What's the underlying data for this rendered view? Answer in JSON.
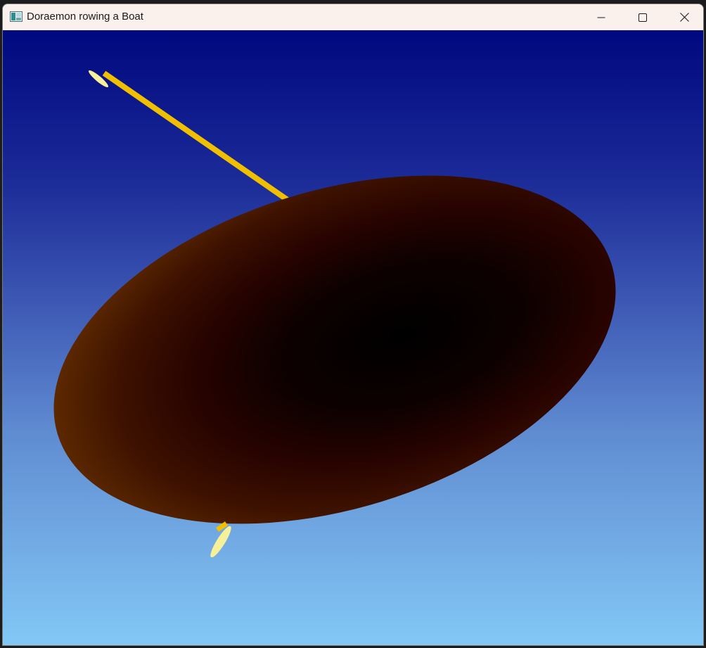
{
  "window": {
    "title": "Doraemon rowing a Boat",
    "icon": "window-app-icon"
  },
  "controls": {
    "minimize_icon": "minimize-icon",
    "maximize_icon": "maximize-icon",
    "close_icon": "close-icon"
  },
  "scene": {
    "sky_colors": [
      "#00087f",
      "#82c8f5"
    ],
    "boat_color": "#5c2800",
    "oar_color": "#f0c000",
    "oar_blade_color": "#f6f09a"
  }
}
